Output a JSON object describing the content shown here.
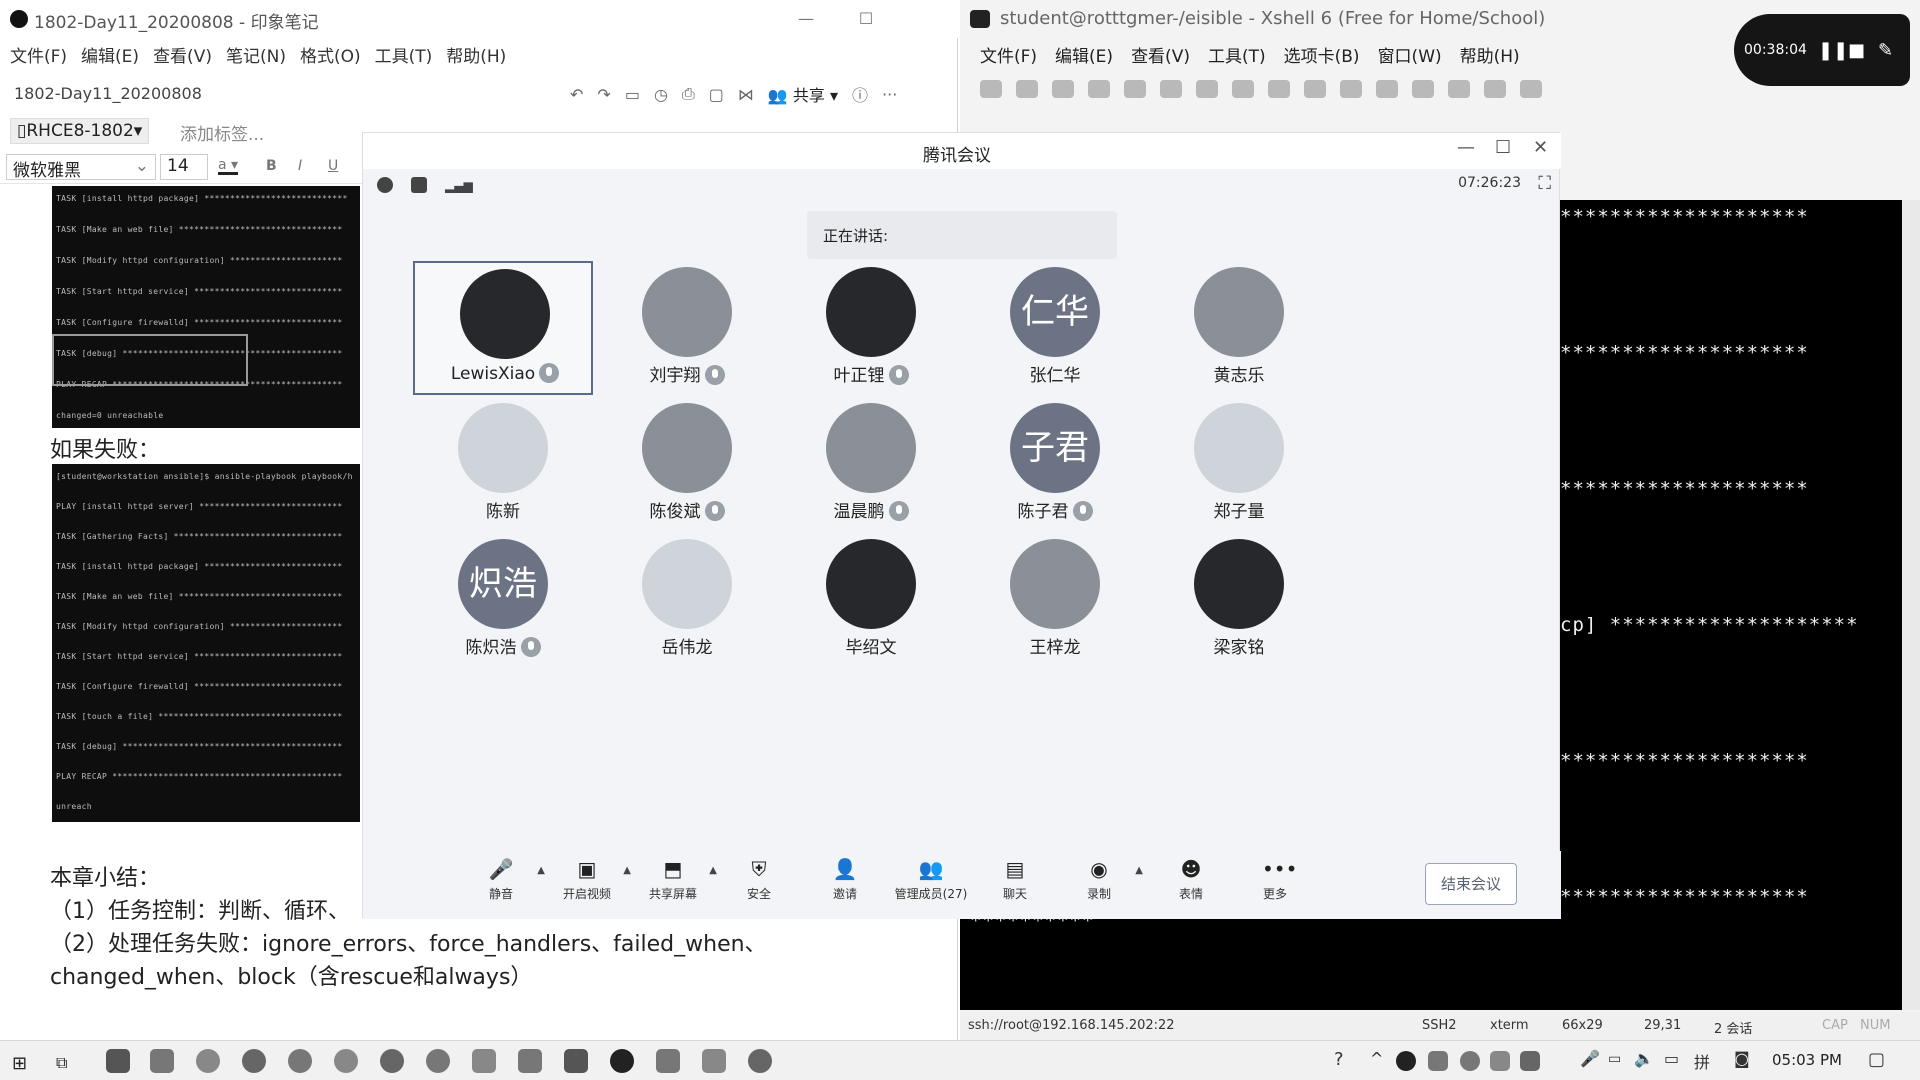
{
  "evernote": {
    "title": "1802-Day11_20200808 - 印象笔记",
    "menu": [
      "文件(F)",
      "编辑(E)",
      "查看(V)",
      "笔记(N)",
      "格式(O)",
      "工具(T)",
      "帮助(H)"
    ],
    "note_title": "1802-Day11_20200808",
    "share_label": "共享",
    "notebook": "RHCE8-1802",
    "add_tag": "添加标签...",
    "font_name": "微软雅黑",
    "font_size": "14",
    "fail_heading": "如果失败：",
    "summary_title": "本章小结：",
    "summary_line1": "（1）任务控制：判断、循环、",
    "summary_line2": "（2）处理任务失败：ignore_errors、force_handlers、failed_when、",
    "summary_line3": "changed_when、block（含rescue和always）",
    "term1_lines": [
      "TASK [install httpd package] ****************************",
      "TASK [Make an web file] ********************************",
      "TASK [Modify httpd configuration] **********************",
      "TASK [Start httpd service] *****************************",
      "TASK [Configure firewalld] *****************************",
      "TASK [debug] *******************************************",
      "PLAY RECAP *********************************************",
      "changed=0    unreachable"
    ],
    "term2_lines": [
      "[student@workstation ansible]$ ansible-playbook playbook/h",
      "PLAY [install httpd server] ****************************",
      "TASK [Gathering Facts] *********************************",
      "TASK [install httpd package] ***************************",
      "TASK [Make an web file] ********************************",
      "TASK [Modify httpd configuration] **********************",
      "TASK [Start httpd service] *****************************",
      "TASK [Configure firewalld] *****************************",
      "TASK [touch a file] ************************************",
      "TASK [debug] *******************************************",
      "PLAY RECAP *********************************************",
      "unreach"
    ]
  },
  "xshell": {
    "title": "student@rotttgmer-/eisible - Xshell 6 (Free for Home/School)",
    "menu": [
      "文件(F)",
      "编辑(E)",
      "查看(V)",
      "工具(T)",
      "选项卡(B)",
      "窗口(W)",
      "帮助(H)"
    ],
    "stars": "********************",
    "cp_line": "cp]  ********************",
    "bottom_stars": "**********",
    "status": {
      "conn": "ssh://root@192.168.145.202:22",
      "proto": "SSH2",
      "term": "xterm",
      "size": "66x29",
      "pos": "29,31",
      "sessions": "2 会话",
      "cap": "CAP",
      "num": "NUM"
    }
  },
  "recorder": {
    "time": "00:38:04"
  },
  "meeting": {
    "title": "腾讯会议",
    "time": "07:26:23",
    "speaking": "正在讲话:",
    "participants": [
      {
        "name": "LewisXiao",
        "avatar": "",
        "mic": true,
        "selected": true,
        "style": "dark"
      },
      {
        "name": "刘宇翔",
        "avatar": "",
        "mic": true,
        "style": "mid"
      },
      {
        "name": "叶正锂",
        "avatar": "",
        "mic": true,
        "style": "dark"
      },
      {
        "name": "张仁华",
        "avatar": "仁华",
        "mic": false,
        "style": "txt"
      },
      {
        "name": "黄志乐",
        "avatar": "",
        "mic": false,
        "style": "mid"
      },
      {
        "name": "陈新",
        "avatar": "",
        "mic": false,
        "style": "light"
      },
      {
        "name": "陈俊斌",
        "avatar": "",
        "mic": true,
        "style": "mid"
      },
      {
        "name": "温晨鹏",
        "avatar": "",
        "mic": true,
        "style": "mid"
      },
      {
        "name": "陈子君",
        "avatar": "子君",
        "mic": true,
        "style": "txt"
      },
      {
        "name": "郑子量",
        "avatar": "",
        "mic": false,
        "style": "light"
      },
      {
        "name": "陈炽浩",
        "avatar": "炽浩",
        "mic": true,
        "style": "txt"
      },
      {
        "name": "岳伟龙",
        "avatar": "",
        "mic": false,
        "style": "light"
      },
      {
        "name": "毕绍文",
        "avatar": "",
        "mic": false,
        "style": "dark"
      },
      {
        "name": "王梓龙",
        "avatar": "",
        "mic": false,
        "style": "mid"
      },
      {
        "name": "梁家铭",
        "avatar": "",
        "mic": false,
        "style": "dark"
      }
    ],
    "toolbar": [
      {
        "label": "静音",
        "icon": "mic-icon",
        "glyph": "🎤",
        "arrow": true
      },
      {
        "label": "开启视频",
        "icon": "video-icon",
        "glyph": "▣",
        "arrow": true
      },
      {
        "label": "共享屏幕",
        "icon": "share-screen-icon",
        "glyph": "⬒",
        "arrow": true
      },
      {
        "label": "安全",
        "icon": "shield-icon",
        "glyph": "⛨",
        "arrow": false
      },
      {
        "label": "邀请",
        "icon": "invite-icon",
        "glyph": "👤",
        "arrow": false
      },
      {
        "label": "管理成员(27)",
        "icon": "members-icon",
        "glyph": "👥",
        "arrow": false
      },
      {
        "label": "聊天",
        "icon": "chat-icon",
        "glyph": "▤",
        "arrow": false
      },
      {
        "label": "录制",
        "icon": "record-icon",
        "glyph": "◉",
        "arrow": true
      },
      {
        "label": "表情",
        "icon": "emoji-icon",
        "glyph": "☻",
        "arrow": false
      },
      {
        "label": "更多",
        "icon": "more-icon",
        "glyph": "•••",
        "arrow": false
      }
    ],
    "end_label": "结束会议"
  },
  "taskbar": {
    "clock": "05:03 PM"
  }
}
